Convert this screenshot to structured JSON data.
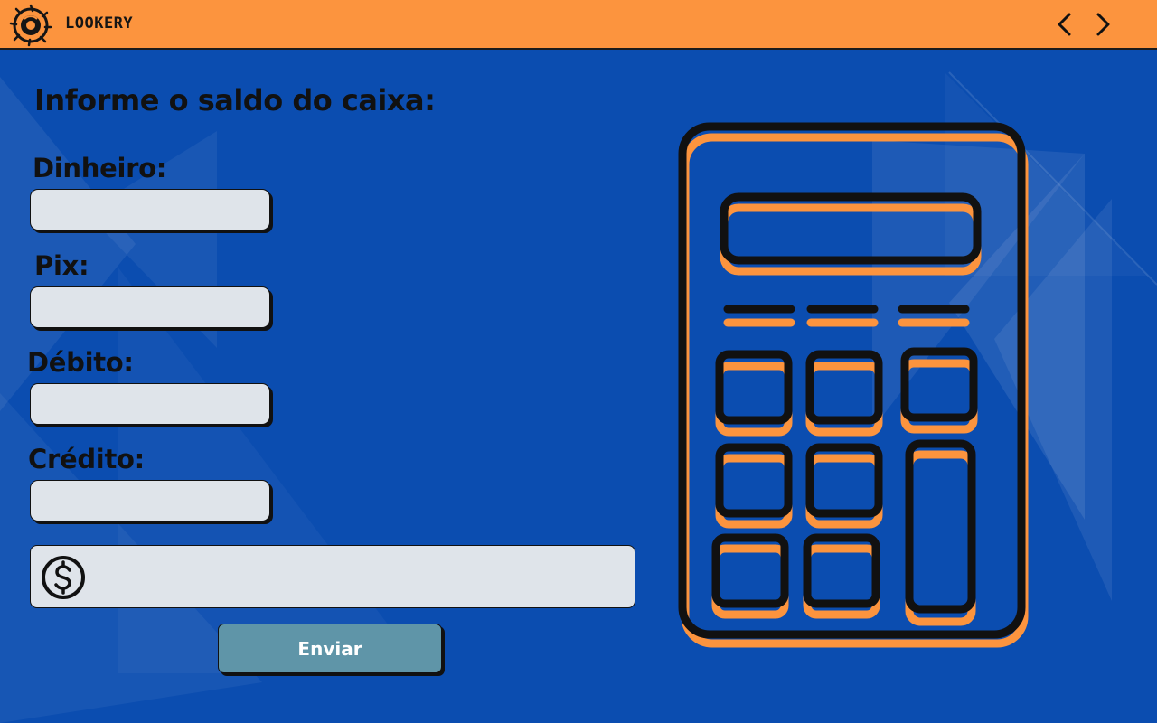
{
  "app": {
    "brand": "LOOKERY"
  },
  "nav": {
    "back_icon": "chevron-left-icon",
    "forward_icon": "chevron-right-icon"
  },
  "form": {
    "heading": "Informe o saldo do caixa:",
    "fields": [
      {
        "label": "Dinheiro:",
        "value": "",
        "placeholder": ""
      },
      {
        "label": "Pix:",
        "value": "",
        "placeholder": ""
      },
      {
        "label": "Débito:",
        "value": "",
        "placeholder": ""
      },
      {
        "label": "Crédito:",
        "value": "",
        "placeholder": ""
      }
    ],
    "total": {
      "icon": "dollar-circle-icon",
      "value": "",
      "placeholder": ""
    },
    "submit_label": "Enviar"
  },
  "illustration": {
    "icon": "calculator-illustration"
  },
  "colors": {
    "background": "#0b4db0",
    "topbar": "#fc943e",
    "accent": "#fc943e",
    "field": "#dfe4ea",
    "button": "#5f95a8",
    "text": "#111111"
  }
}
